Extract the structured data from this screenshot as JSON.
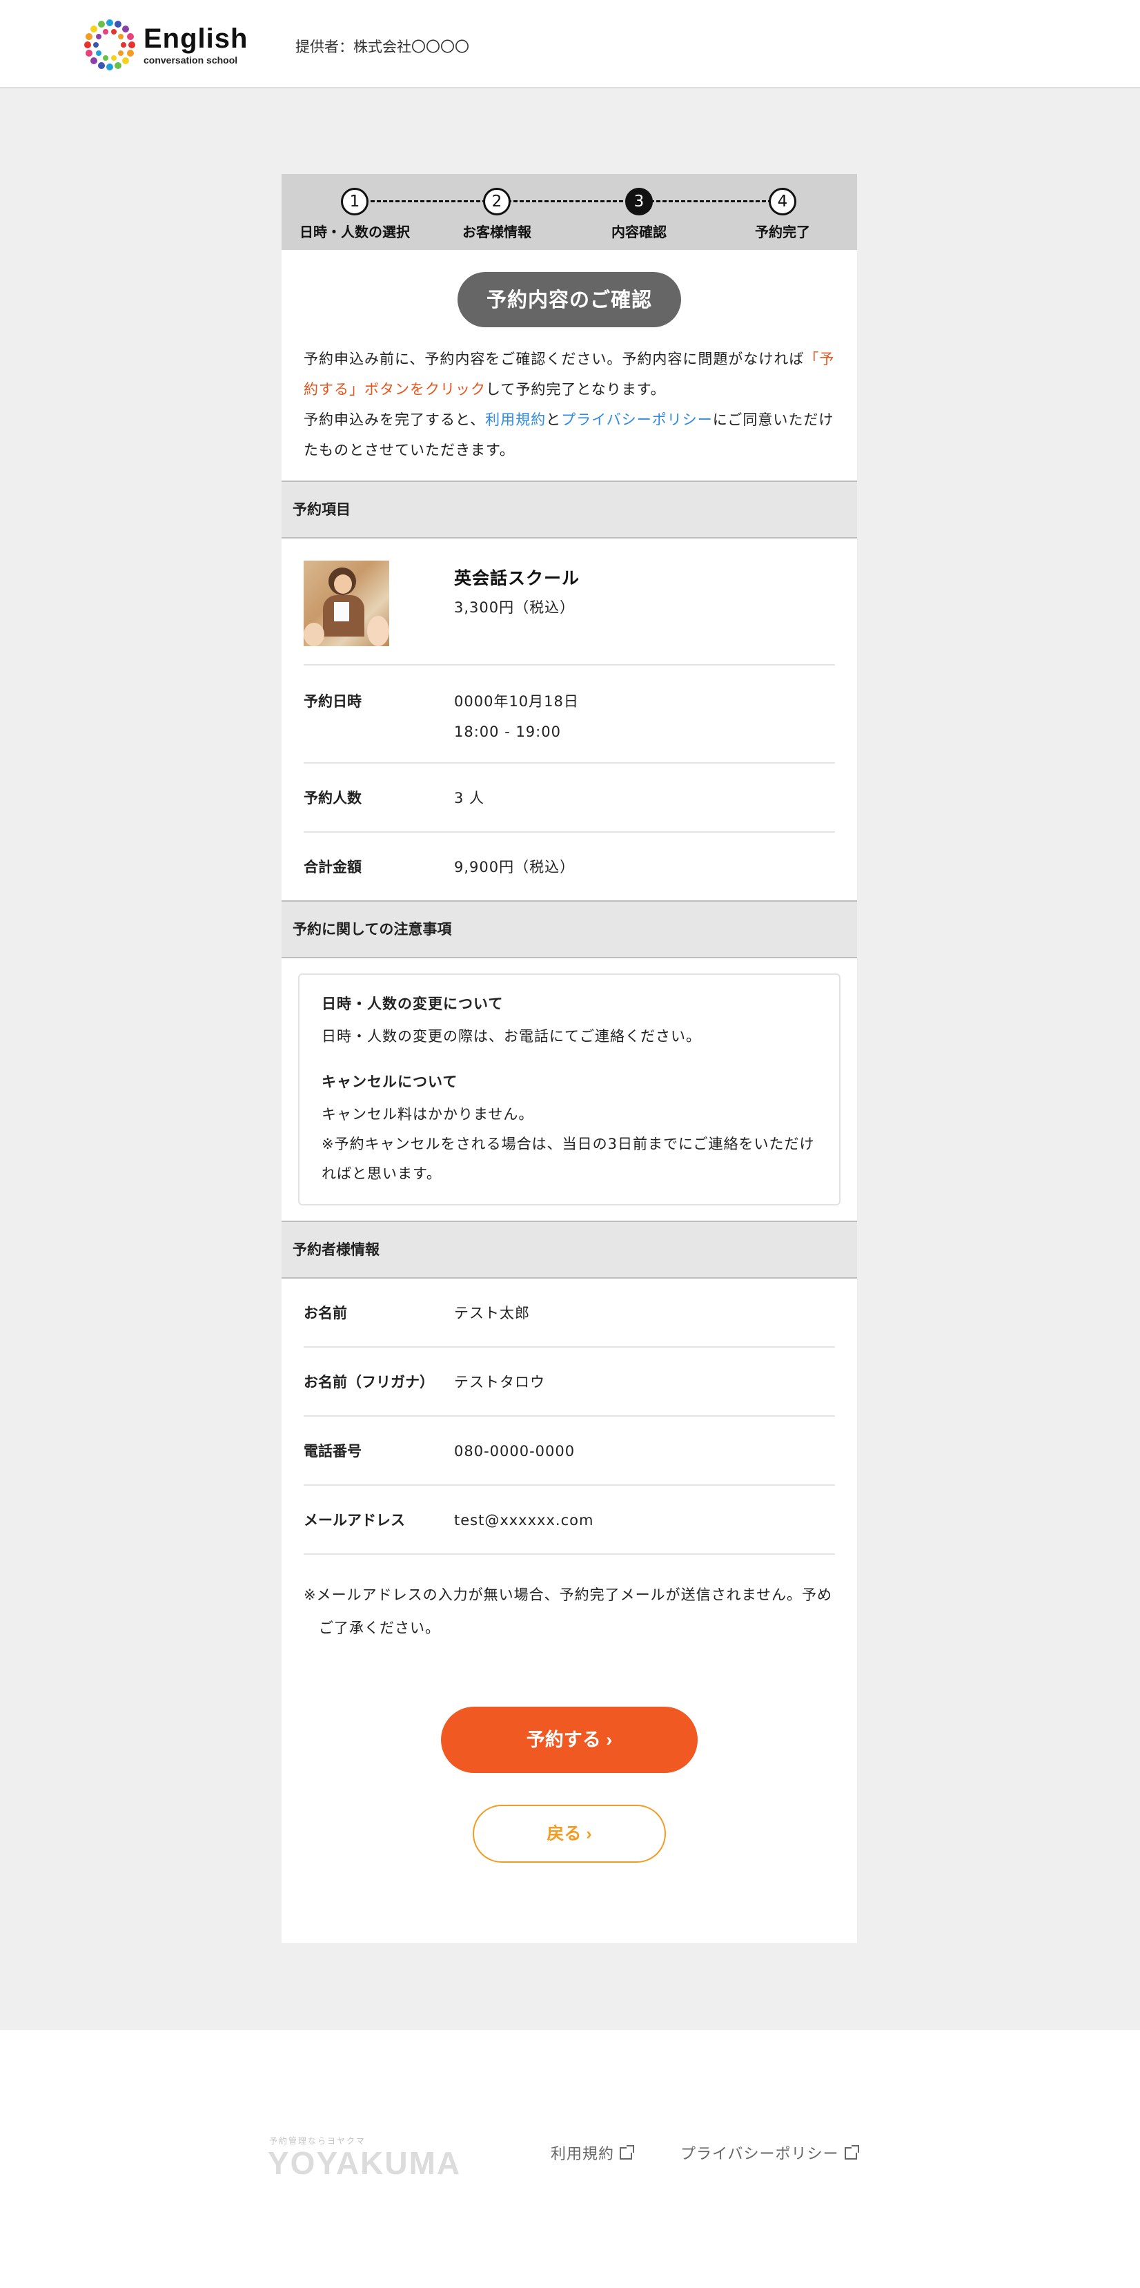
{
  "header": {
    "logo_title": "English",
    "logo_sub": "conversation school",
    "provider": "提供者：株式会社〇〇〇〇"
  },
  "steps": [
    {
      "num": "1",
      "label": "日時・人数の選択"
    },
    {
      "num": "2",
      "label": "お客様情報"
    },
    {
      "num": "3",
      "label": "内容確認"
    },
    {
      "num": "4",
      "label": "予約完了"
    }
  ],
  "current_step": 3,
  "confirm_title": "予約内容のご確認",
  "intro": {
    "p1a": "予約申込み前に、予約内容をご確認ください。予約内容に問題がなければ",
    "p1b": "「予約する」ボタンをクリック",
    "p1c": "して予約完了となります。",
    "p2a": "予約申込みを完了すると、",
    "terms": "利用規約",
    "and": "と",
    "privacy": "プライバシーポリシー",
    "p2b": "にご同意いただけたものとさせていただきます。"
  },
  "reservation": {
    "heading": "予約項目",
    "item_name": "英会話スクール",
    "item_price": "3,300円（税込）",
    "rows": [
      {
        "label": "予約日時",
        "line1": "0000年10月18日",
        "line2": "18:00 - 19:00"
      },
      {
        "label": "予約人数",
        "line1": "3 人"
      },
      {
        "label": "合計金額",
        "line1": "9,900円（税込）"
      }
    ]
  },
  "notes": {
    "heading": "予約に関しての注意事項",
    "change_title": "日時・人数の変更について",
    "change_body": "日時・人数の変更の際は、お電話にてご連絡ください。",
    "cancel_title": "キャンセルについて",
    "cancel_body1": "キャンセル料はかかりません。",
    "cancel_body2": "※予約キャンセルをされる場合は、当日の3日前までにご連絡をいただければと思います。"
  },
  "customer": {
    "heading": "予約者様情報",
    "rows": [
      {
        "label": "お名前",
        "value": "テスト太郎"
      },
      {
        "label": "お名前（フリガナ）",
        "value": "テストタロウ"
      },
      {
        "label": "電話番号",
        "value": "080-0000-0000"
      },
      {
        "label": "メールアドレス",
        "value": "test@xxxxxx.com"
      }
    ],
    "mail_note": "※メールアドレスの入力が無い場合、予約完了メールが送信されません。予めご了承ください。"
  },
  "buttons": {
    "reserve": "予約する ›",
    "back": "戻る ›"
  },
  "footer": {
    "tagline": "予約管理ならヨヤクマ",
    "brand": "YOYAKUMA",
    "links": [
      "利用規約",
      "プライバシーポリシー"
    ]
  },
  "colors": {
    "accent": "#f05a22",
    "back_button": "#f39c24",
    "link": "#2f8be0"
  }
}
